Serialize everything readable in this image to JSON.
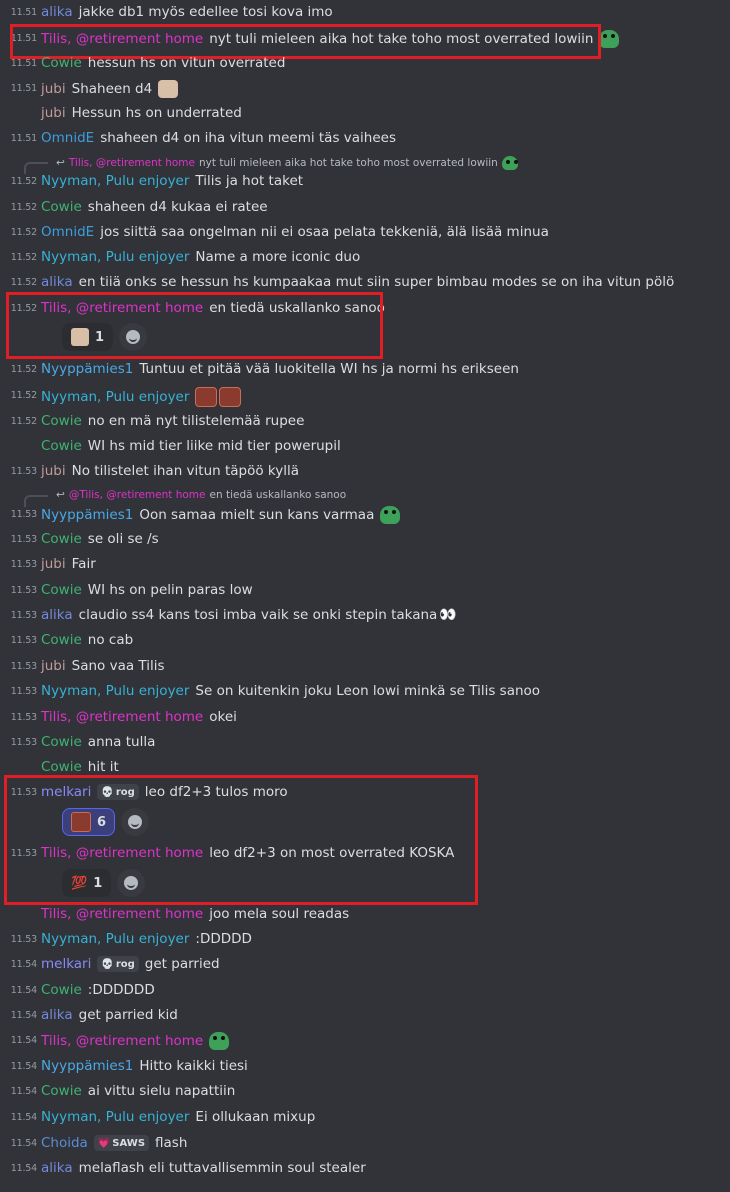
{
  "colors": {
    "alika": "#7289da",
    "tilis": "#dd33c9",
    "cowie": "#3fb472",
    "jubi": "#c39a9a",
    "omnide": "#3d9ede",
    "nyyman": "#38b1d6",
    "nyyppamies1": "#4aa8e5",
    "melkari": "#8a8af5",
    "choida": "#5b8dd6",
    "highlight": "#e01e25"
  },
  "messages": [
    {
      "id": "m1",
      "ts": "11.51",
      "author": "alika",
      "text": "jakke db1 myös edellee tosi kova imo"
    },
    {
      "id": "m2",
      "ts": "11.51",
      "author": "Tilis, @retirement home",
      "text": "nyt tuli mieleen aika hot take toho most overrated lowiin"
    },
    {
      "id": "m3",
      "ts": "11.51",
      "author": "Cowie",
      "text": "hessun hs on vitun overrated"
    },
    {
      "id": "m4",
      "ts": "11.51",
      "author": "jubi",
      "text": "Shaheen d4"
    },
    {
      "id": "m5",
      "ts": "",
      "author": "jubi",
      "text": "Hessun hs on underrated"
    },
    {
      "id": "m6",
      "ts": "11.51",
      "author": "OmnidE",
      "text": "shaheen d4 on iha vitun meemi täs vaihees"
    },
    {
      "id": "m7",
      "ts": "11.52",
      "author": "Nyyman, Pulu enjoyer",
      "text": "Tilis ja hot taket",
      "reply": {
        "author": "Tilis, @retirement home",
        "text": "nyt tuli mieleen aika hot take toho most overrated lowiin"
      }
    },
    {
      "id": "m8",
      "ts": "11.52",
      "author": "Cowie",
      "text": "shaheen d4 kukaa ei ratee"
    },
    {
      "id": "m9",
      "ts": "11.52",
      "author": "OmnidE",
      "text": "jos siittä saa ongelman nii ei osaa pelata tekkeniä, älä lisää minua"
    },
    {
      "id": "m10",
      "ts": "11.52",
      "author": "Nyyman, Pulu enjoyer",
      "text": "Name a more iconic duo"
    },
    {
      "id": "m11",
      "ts": "11.52",
      "author": "alika",
      "text": "en tiiä onks se hessun hs kumpaakaa mut siin super bimbau modes se on iha vitun pölö"
    },
    {
      "id": "m12",
      "ts": "11.52",
      "author": "Tilis, @retirement home",
      "text": "en tiedä uskallanko sanoo",
      "reaction_count": "1"
    },
    {
      "id": "m13",
      "ts": "11.52",
      "author": "Nyyppämies1",
      "text": "Tuntuu et pitää vää luokitella WI hs ja normi hs erikseen"
    },
    {
      "id": "m14",
      "ts": "11.52",
      "author": "Nyyman, Pulu enjoyer",
      "text": ""
    },
    {
      "id": "m15",
      "ts": "11.52",
      "author": "Cowie",
      "text": "no en mä nyt tilistelemää rupee"
    },
    {
      "id": "m16",
      "ts": "",
      "author": "Cowie",
      "text": "WI hs mid tier liike mid tier powerupil"
    },
    {
      "id": "m17",
      "ts": "11.53",
      "author": "jubi",
      "text": "No tilistelet ihan vitun täpöö kyllä"
    },
    {
      "id": "m18",
      "ts": "11.53",
      "author": "Nyyppämies1",
      "text": "Oon samaa mielt sun kans varmaa",
      "reply": {
        "author": "@Tilis, @retirement home",
        "text": "en tiedä uskallanko sanoo"
      }
    },
    {
      "id": "m19",
      "ts": "11.53",
      "author": "Cowie",
      "text": "se oli se /s"
    },
    {
      "id": "m20",
      "ts": "11.53",
      "author": "jubi",
      "text": "Fair"
    },
    {
      "id": "m21",
      "ts": "11.53",
      "author": "Cowie",
      "text": "WI hs on pelin paras low"
    },
    {
      "id": "m22",
      "ts": "11.53",
      "author": "alika",
      "text": "claudio ss4 kans tosi imba vaik se onki stepin takana"
    },
    {
      "id": "m23",
      "ts": "11.53",
      "author": "Cowie",
      "text": "no cab"
    },
    {
      "id": "m24",
      "ts": "11.53",
      "author": "jubi",
      "text": "Sano vaa Tilis"
    },
    {
      "id": "m25",
      "ts": "11.53",
      "author": "Nyyman, Pulu enjoyer",
      "text": "Se on kuitenkin joku Leon lowi minkä se Tilis sanoo"
    },
    {
      "id": "m26",
      "ts": "11.53",
      "author": "Tilis, @retirement home",
      "text": "okei"
    },
    {
      "id": "m27",
      "ts": "11.53",
      "author": "Cowie",
      "text": "anna tulla"
    },
    {
      "id": "m28",
      "ts": "",
      "author": "Cowie",
      "text": "hit it"
    },
    {
      "id": "m29",
      "ts": "11.53",
      "author": "melkari",
      "tag": "rog",
      "text": "leo df2+3 tulos moro",
      "reaction_count": "6"
    },
    {
      "id": "m30",
      "ts": "11.53",
      "author": "Tilis, @retirement home",
      "text": "leo df2+3 on most overrated KOSKA",
      "reaction_count": "1"
    },
    {
      "id": "m31",
      "ts": "",
      "author": "Tilis, @retirement home",
      "text": "joo mela soul readas"
    },
    {
      "id": "m32",
      "ts": "11.53",
      "author": "Nyyman, Pulu enjoyer",
      "text": ":DDDDD"
    },
    {
      "id": "m33",
      "ts": "11.54",
      "author": "melkari",
      "tag": "rog",
      "text": "get parried"
    },
    {
      "id": "m34",
      "ts": "11.54",
      "author": "Cowie",
      "text": ":DDDDDD"
    },
    {
      "id": "m35",
      "ts": "11.54",
      "author": "alika",
      "text": "get parried kid"
    },
    {
      "id": "m36",
      "ts": "11.54",
      "author": "Tilis, @retirement home",
      "text": ""
    },
    {
      "id": "m37",
      "ts": "11.54",
      "author": "Nyyppämies1",
      "text": "Hitto kaikki tiesi"
    },
    {
      "id": "m38",
      "ts": "11.54",
      "author": "Cowie",
      "text": "ai vittu sielu napattiin"
    },
    {
      "id": "m39",
      "ts": "11.54",
      "author": "Nyyman, Pulu enjoyer",
      "text": "Ei ollukaan mixup"
    },
    {
      "id": "m40",
      "ts": "11.54",
      "author": "Choida",
      "tag": "SAWS",
      "text": "flash"
    },
    {
      "id": "m41",
      "ts": "11.54",
      "author": "alika",
      "text": "melaflash eli tuttavallisemmin soul stealer"
    }
  ]
}
